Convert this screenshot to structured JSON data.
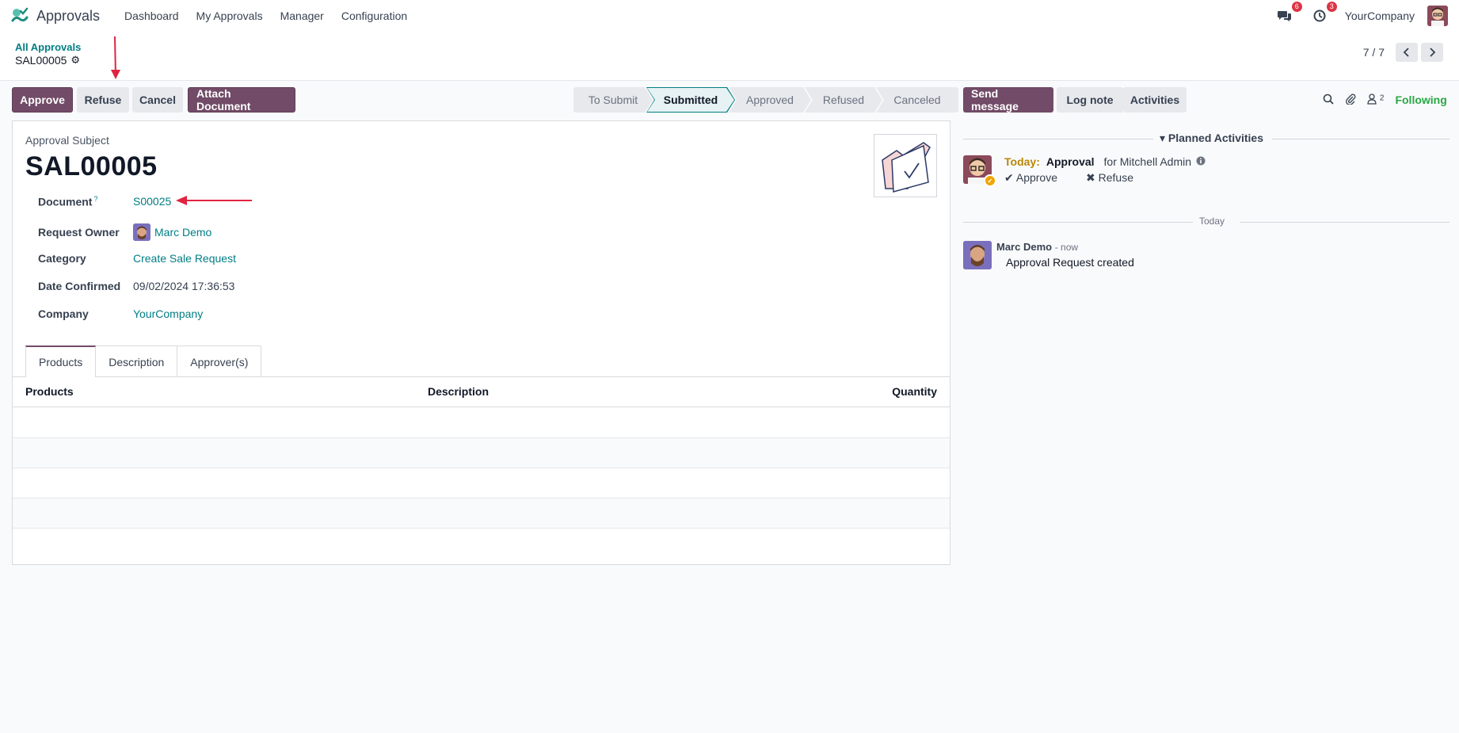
{
  "navbar": {
    "app_name": "Approvals",
    "menu": [
      "Dashboard",
      "My Approvals",
      "Manager",
      "Configuration"
    ],
    "messages_badge": "6",
    "activities_badge": "3",
    "company": "YourCompany"
  },
  "breadcrumb": {
    "parent": "All Approvals",
    "current": "SAL00005"
  },
  "pager": {
    "value": "7 / 7",
    "prev_icon": "chevron-left-icon",
    "next_icon": "chevron-right-icon"
  },
  "actions": {
    "approve": "Approve",
    "refuse": "Refuse",
    "cancel": "Cancel",
    "attach": "Attach Document"
  },
  "statusbar": {
    "stages": [
      "To Submit",
      "Submitted",
      "Approved",
      "Refused",
      "Canceled"
    ],
    "active": "Submitted"
  },
  "form": {
    "subject_label": "Approval Subject",
    "name": "SAL00005",
    "fields": {
      "document_label": "Document",
      "document_help": "?",
      "document_value": "S00025",
      "owner_label": "Request Owner",
      "owner_value": "Marc Demo",
      "category_label": "Category",
      "category_value": "Create Sale Request",
      "date_label": "Date Confirmed",
      "date_value": "09/02/2024 17:36:53",
      "company_label": "Company",
      "company_value": "YourCompany"
    },
    "tabs": [
      "Products",
      "Description",
      "Approver(s)"
    ],
    "active_tab": "Products",
    "table_headers": [
      "Products",
      "Description",
      "Quantity"
    ]
  },
  "chatter": {
    "send_message": "Send message",
    "log_note": "Log note",
    "activities": "Activities",
    "followers_count": "2",
    "following": "Following",
    "planned_title": "Planned Activities",
    "activity": {
      "when": "Today:",
      "type": "Approval",
      "for": "for Mitchell Admin",
      "approve": "Approve",
      "refuse": "Refuse"
    },
    "day_separator": "Today",
    "message": {
      "author": "Marc Demo",
      "time": "- now",
      "body": "Approval Request created"
    }
  },
  "colors": {
    "primary": "#714b67",
    "link": "#017e84",
    "annotation_arrow": "#e0243f",
    "following": "#28a745"
  }
}
